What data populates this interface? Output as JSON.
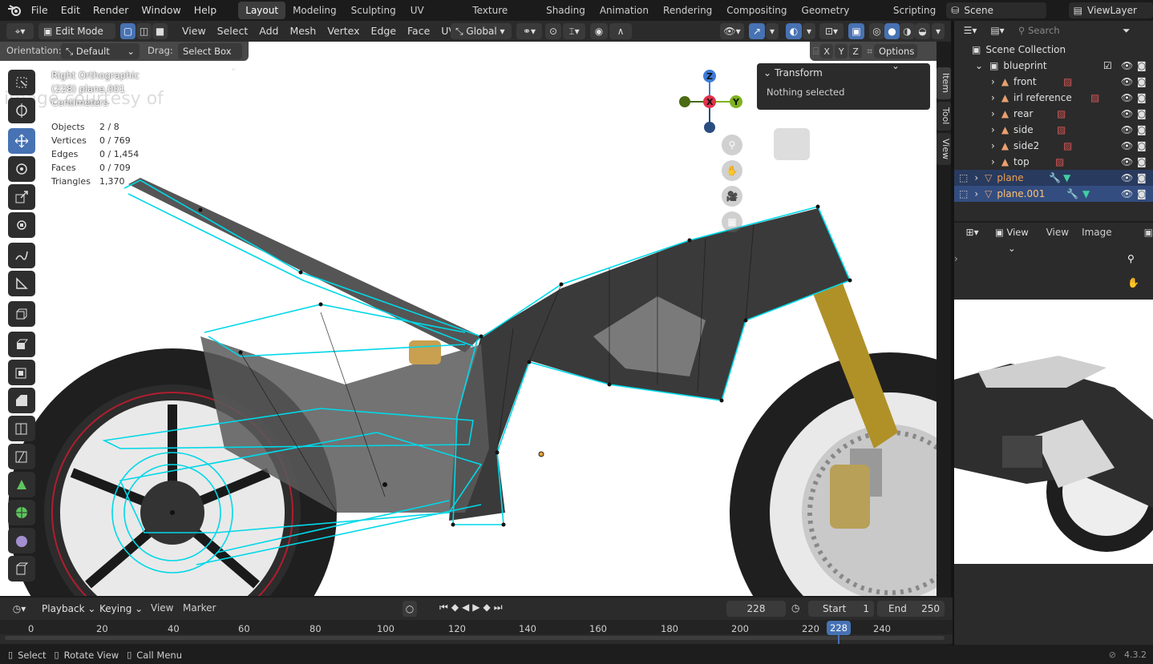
{
  "menu": [
    "File",
    "Edit",
    "Render",
    "Window",
    "Help"
  ],
  "workspaces": [
    "Layout",
    "Modeling",
    "Sculpting",
    "UV Editing",
    "Texture Paint",
    "Shading",
    "Animation",
    "Rendering",
    "Compositing",
    "Geometry Nodes",
    "Scripting"
  ],
  "scene": {
    "label": "Scene",
    "view_layer": "ViewLayer"
  },
  "viewport_header": {
    "mode": "Edit Mode",
    "menus": [
      "View",
      "Select",
      "Add",
      "Mesh",
      "Vertex",
      "Edge",
      "Face",
      "UV"
    ],
    "transform_orientation": "Global",
    "orientation_label": "Orientation:",
    "orientation_value": "Default",
    "drag_label": "Drag:",
    "drag_value": "Select Box",
    "axes": [
      "X",
      "Y",
      "Z"
    ],
    "options": "Options"
  },
  "overlay_info": {
    "view": "Right Orthographic",
    "object": "(228) plane.001",
    "units": "Centimeters",
    "stats": [
      {
        "label": "Objects",
        "value": "2 / 8"
      },
      {
        "label": "Vertices",
        "value": "0 / 769"
      },
      {
        "label": "Edges",
        "value": "0 / 1,454"
      },
      {
        "label": "Faces",
        "value": "0 / 709"
      },
      {
        "label": "Triangles",
        "value": "1,370"
      }
    ]
  },
  "gizmo": {
    "z": "Z",
    "x": "X",
    "y": "Y"
  },
  "npanel": {
    "title": "Transform",
    "message": "Nothing selected",
    "tabs": [
      "Item",
      "Tool",
      "View"
    ]
  },
  "outliner": {
    "search_placeholder": "Search",
    "collection": "Scene Collection",
    "rows": [
      {
        "name": "blueprint",
        "indent": 1
      },
      {
        "name": "front",
        "indent": 2
      },
      {
        "name": "irl reference",
        "indent": 2
      },
      {
        "name": "rear",
        "indent": 2
      },
      {
        "name": "side",
        "indent": 2
      },
      {
        "name": "side2",
        "indent": 2
      },
      {
        "name": "top",
        "indent": 2
      },
      {
        "name": "plane",
        "indent": 1,
        "selected": true
      },
      {
        "name": "plane.001",
        "indent": 1,
        "selected": true
      }
    ]
  },
  "image_editor": {
    "view": "View",
    "menu_view": "View",
    "menu_image": "Image"
  },
  "timeline": {
    "menus": [
      "Playback",
      "Keying",
      "View",
      "Marker"
    ],
    "current_frame": "228",
    "start_label": "Start",
    "start": "1",
    "end_label": "End",
    "end": "250",
    "ticks": [
      "0",
      "20",
      "40",
      "60",
      "80",
      "100",
      "120",
      "140",
      "160",
      "180",
      "200",
      "220",
      "240"
    ],
    "playhead": "228"
  },
  "statusbar": {
    "items": [
      "Select",
      "Rotate View",
      "Call Menu"
    ],
    "version": "4.3.2"
  },
  "colors": {
    "accent": "#4772b3",
    "wire": "#00d8e8",
    "header": "#2b2b2b",
    "bg": "#1d1d1d"
  }
}
